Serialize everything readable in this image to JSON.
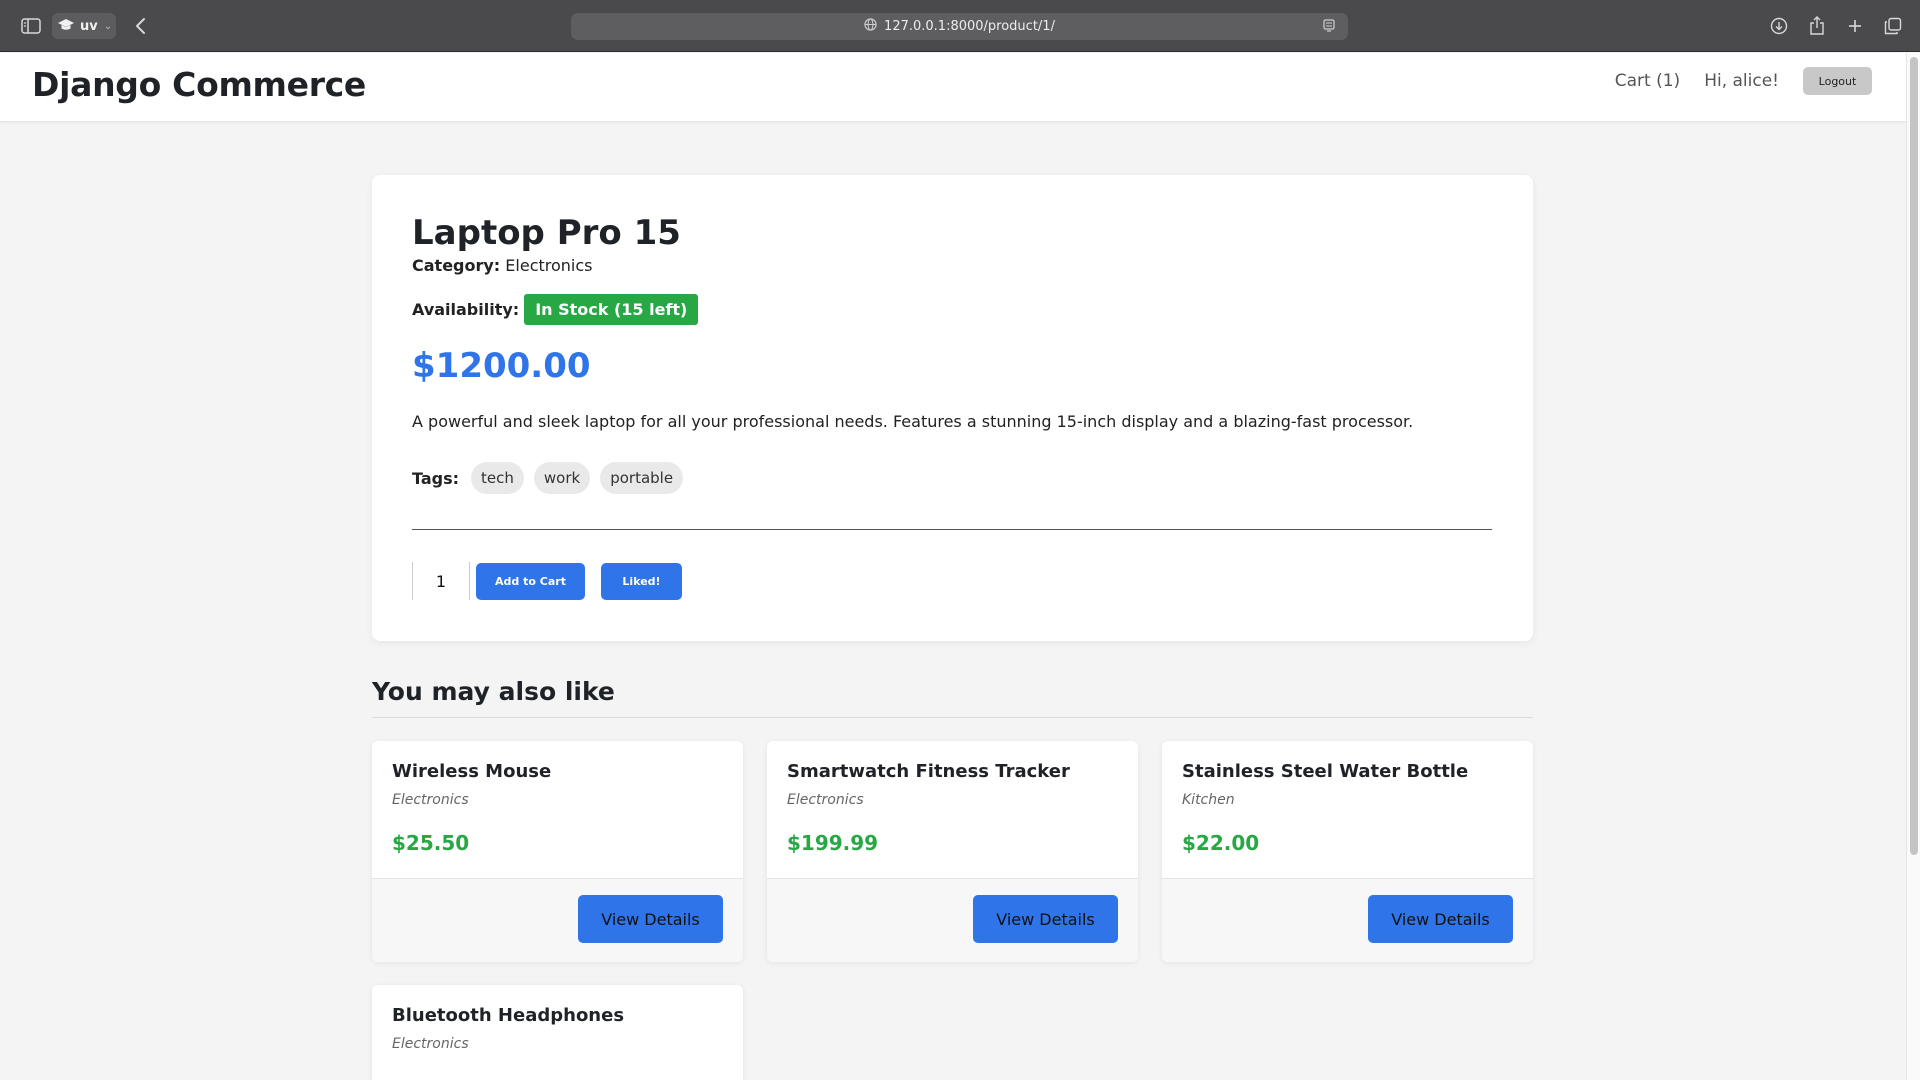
{
  "browser": {
    "profile_name": "uv",
    "url": "127.0.0.1:8000/product/1/"
  },
  "header": {
    "brand": "Django Commerce",
    "cart_link": "Cart (1)",
    "greeting": "Hi, alice!",
    "logout_label": "Logout"
  },
  "product": {
    "title": "Laptop Pro 15",
    "category_label": "Category:",
    "category": "Electronics",
    "availability_label": "Availability:",
    "stock_badge": "In Stock (15 left)",
    "price": "$1200.00",
    "description": "A powerful and sleek laptop for all your professional needs. Features a stunning 15-inch display and a blazing-fast processor.",
    "tags_label": "Tags:",
    "tags": [
      "tech",
      "work",
      "portable"
    ],
    "quantity": "1",
    "add_to_cart_label": "Add to Cart",
    "like_label": "Liked!"
  },
  "related": {
    "heading": "You may also like",
    "view_label": "View Details",
    "items": [
      {
        "name": "Wireless Mouse",
        "category": "Electronics",
        "price": "$25.50"
      },
      {
        "name": "Smartwatch Fitness Tracker",
        "category": "Electronics",
        "price": "$199.99"
      },
      {
        "name": "Stainless Steel Water Bottle",
        "category": "Kitchen",
        "price": "$22.00"
      },
      {
        "name": "Bluetooth Headphones",
        "category": "Electronics",
        "price": ""
      }
    ]
  },
  "colors": {
    "accent": "#2f74e8",
    "success": "#28a745",
    "background": "#f4f4f5"
  },
  "icons": [
    "sidebar-icon",
    "graduation-cap-icon",
    "chevron-down-icon",
    "back-icon",
    "globe-icon",
    "reader-icon",
    "download-icon",
    "share-icon",
    "plus-icon",
    "tabs-icon"
  ]
}
